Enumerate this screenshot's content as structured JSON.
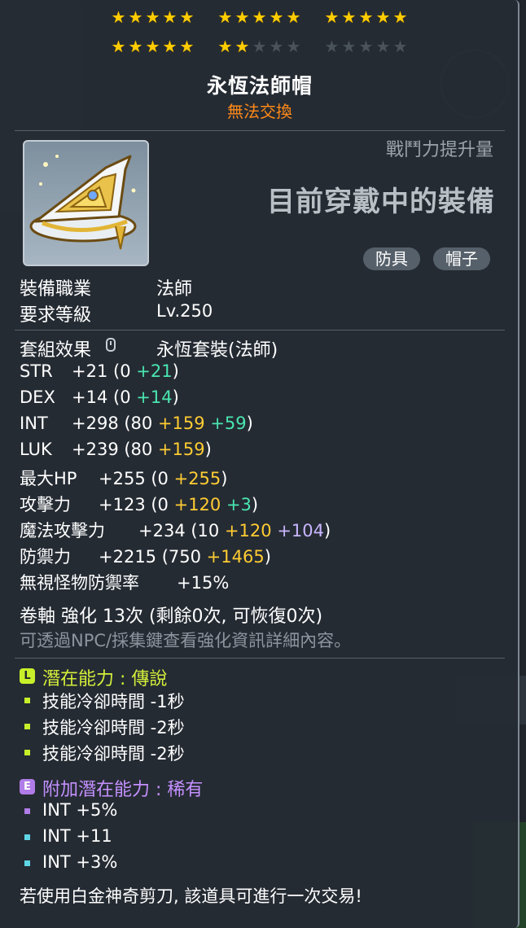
{
  "stars": {
    "row1": [
      5,
      5,
      5
    ],
    "row2": [
      5,
      2,
      0
    ],
    "per_group": 5
  },
  "item": {
    "name": "永恆法師帽",
    "trade_status": "無法交換"
  },
  "header_right": {
    "power_label": "戰鬥力提升量",
    "equipped_label": "目前穿戴中的裝備"
  },
  "tags": [
    "防具",
    "帽子"
  ],
  "requirements": {
    "job_label": "裝備職業",
    "job_value": "法師",
    "level_label": "要求等級",
    "level_value": "Lv.250"
  },
  "set": {
    "label": "套組效果",
    "value": "永恆套裝(法師)"
  },
  "stats": [
    {
      "label": "STR",
      "total": "+21",
      "base": "(0",
      "parts": [
        {
          "text": "+21",
          "color": "green"
        }
      ],
      "close": ")"
    },
    {
      "label": "DEX",
      "total": "+14",
      "base": "(0",
      "parts": [
        {
          "text": "+14",
          "color": "green"
        }
      ],
      "close": ")"
    },
    {
      "label": "INT",
      "total": "+298",
      "base": "(80",
      "parts": [
        {
          "text": "+159",
          "color": "yellow"
        },
        {
          "text": "+59",
          "color": "green"
        }
      ],
      "close": ")"
    },
    {
      "label": "LUK",
      "total": "+239",
      "base": "(80",
      "parts": [
        {
          "text": "+159",
          "color": "yellow"
        }
      ],
      "close": ")"
    },
    {
      "label": "最大HP",
      "total": "+255",
      "base": "(0",
      "parts": [
        {
          "text": "+255",
          "color": "yellow"
        }
      ],
      "close": ")"
    },
    {
      "label": "攻擊力",
      "total": "+123",
      "base": "(0",
      "parts": [
        {
          "text": "+120",
          "color": "yellow"
        },
        {
          "text": "+3",
          "color": "green"
        }
      ],
      "close": ")"
    },
    {
      "label": "魔法攻擊力",
      "total": "+234",
      "base": "(10",
      "parts": [
        {
          "text": "+120",
          "color": "yellow"
        },
        {
          "text": "+104",
          "color": "purple"
        }
      ],
      "close": ")"
    },
    {
      "label": "防禦力",
      "total": "+2215",
      "base": "(750",
      "parts": [
        {
          "text": "+1465",
          "color": "yellow"
        }
      ],
      "close": ")"
    },
    {
      "label": "無視怪物防禦率",
      "total": "+15%",
      "base": "",
      "parts": [],
      "close": ""
    }
  ],
  "enhance": {
    "line": "卷軸 強化 13次 (剩餘0次, 可恢復0次)",
    "note": "可透過NPC/採集鍵查看強化資訊詳細內容。"
  },
  "potential": {
    "badge": "L",
    "heading": "潛在能力 : 傳說",
    "lines": [
      "技能冷卻時間 -1秒",
      "技能冷卻時間 -2秒",
      "技能冷卻時間 -2秒"
    ]
  },
  "bonus_potential": {
    "badge": "E",
    "heading": "附加潛在能力 : 稀有",
    "lines": [
      "INT +5%",
      "INT +11",
      "INT +3%"
    ]
  },
  "footer": "若使用白金神奇剪刀, 該道具可進行一次交易!",
  "colors": {
    "star": "#ffcc00",
    "trade": "#ff8a18",
    "green": "#49e6b0",
    "yellow": "#ffcc33",
    "purple": "#c8b6ff",
    "legendary": "#d4ef3a",
    "rare": "#c490ff"
  }
}
